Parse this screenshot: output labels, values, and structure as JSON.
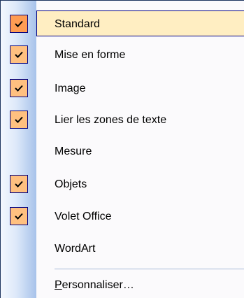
{
  "menu": {
    "items": [
      {
        "label": "Standard",
        "checked": true,
        "highlighted": true
      },
      {
        "label": "Mise en forme",
        "checked": true
      },
      {
        "label": "Image",
        "checked": true
      },
      {
        "label": "Lier les zones de texte",
        "checked": true
      },
      {
        "label": "Mesure",
        "checked": false
      },
      {
        "label": "Objets",
        "checked": true
      },
      {
        "label": "Volet Office",
        "checked": true
      },
      {
        "label": "WordArt",
        "checked": false
      }
    ],
    "customize": {
      "mnemonic": "P",
      "rest": "ersonnaliser…"
    }
  },
  "colors": {
    "highlight_fill": "#ffeec2",
    "highlight_border": "#000080",
    "check_fill": "#ffc080",
    "check_fill_active": "#ff9c53",
    "gutter_gradient_end": "#a7c2ea"
  },
  "icons": {
    "check": "checkmark-icon"
  }
}
